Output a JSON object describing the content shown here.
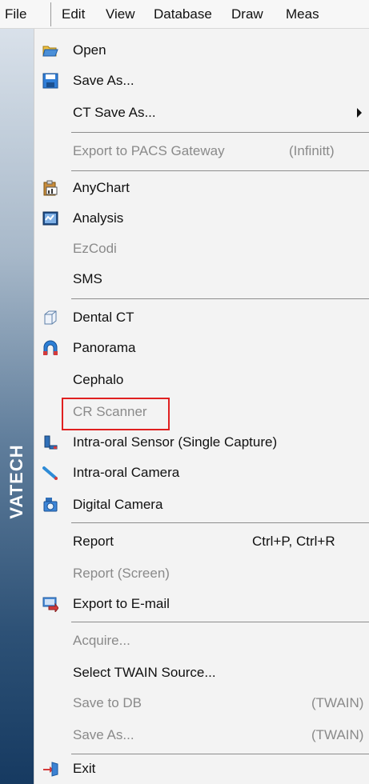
{
  "menubar": {
    "file": "File",
    "edit": "Edit",
    "view": "View",
    "database": "Database",
    "draw": "Draw",
    "meas": "Meas"
  },
  "brand": "VATECH",
  "menu": {
    "open": "Open",
    "save_as": "Save As...",
    "ct_save_as": "CT Save As...",
    "export_pacs": "Export to PACS Gateway",
    "export_pacs_hint": "(Infinitt)",
    "anychart": "AnyChart",
    "analysis": "Analysis",
    "ezcodi": "EzCodi",
    "sms": "SMS",
    "dental_ct": "Dental CT",
    "panorama": "Panorama",
    "cephalo": "Cephalo",
    "cr_scanner": "CR Scanner",
    "intraoral_sensor": "Intra-oral Sensor (Single Capture)",
    "intraoral_camera": "Intra-oral Camera",
    "digital_camera": "Digital Camera",
    "report": "Report",
    "report_shortcut": "Ctrl+P, Ctrl+R",
    "report_screen": "Report (Screen)",
    "export_email": "Export to E-mail",
    "acquire": "Acquire...",
    "select_twain": "Select TWAIN Source...",
    "save_to_db": "Save to DB",
    "save_to_db_hint": "(TWAIN)",
    "save_as_twain": "Save As...",
    "save_as_twain_hint": "(TWAIN)",
    "exit": "Exit"
  },
  "icons": {
    "open": "open-folder-icon",
    "save": "floppy-disk-icon",
    "anychart": "clipboard-chart-icon",
    "analysis": "analysis-icon",
    "dental_ct": "cube-icon",
    "panorama": "panorama-device-icon",
    "intraoral_sensor": "sensor-icon",
    "intraoral_camera": "camera-wand-icon",
    "digital_camera": "digital-camera-icon",
    "export_email": "email-export-icon",
    "exit": "exit-door-icon"
  },
  "colors": {
    "highlight": "#e02020",
    "disabled_text": "#8a8a8a"
  }
}
